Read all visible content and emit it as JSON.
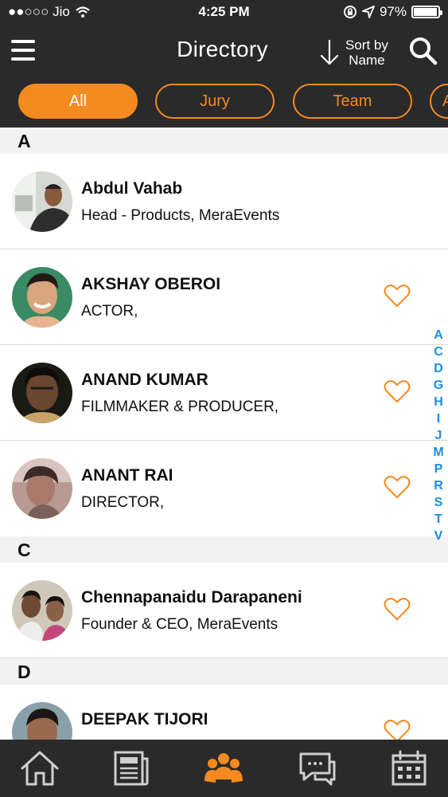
{
  "status_bar": {
    "carrier": "●●○○○ Jio",
    "time": "4:25 PM",
    "battery": "97%",
    "battery_level": 0.97
  },
  "header": {
    "title": "Directory",
    "sort_line1": "Sort by",
    "sort_line2": "Name"
  },
  "filters": [
    {
      "label": "All",
      "active": true
    },
    {
      "label": "Jury",
      "active": false
    },
    {
      "label": "Team",
      "active": false
    },
    {
      "label": "A",
      "active": false
    }
  ],
  "sections": [
    {
      "letter": "A",
      "people": [
        {
          "name": "Abdul Vahab",
          "role": "Head - Products, MeraEvents",
          "favorite_icon": false
        },
        {
          "name": "AKSHAY OBEROI",
          "role": "ACTOR,",
          "favorite_icon": true
        },
        {
          "name": "ANAND KUMAR",
          "role": "FILMMAKER & PRODUCER,",
          "favorite_icon": true
        },
        {
          "name": "ANANT RAI",
          "role": "DIRECTOR,",
          "favorite_icon": true
        }
      ]
    },
    {
      "letter": "C",
      "people": [
        {
          "name": "Chennapanaidu Darapaneni",
          "role": "Founder & CEO, MeraEvents",
          "favorite_icon": true
        }
      ]
    },
    {
      "letter": "D",
      "people": [
        {
          "name": "DEEPAK TIJORI",
          "role": "",
          "favorite_icon": true
        }
      ]
    }
  ],
  "index_letters": [
    "A",
    "C",
    "D",
    "G",
    "H",
    "I",
    "J",
    "M",
    "P",
    "R",
    "S",
    "T",
    "V"
  ],
  "bottom_nav": [
    "home-icon",
    "news-icon",
    "directory-icon",
    "chat-icon",
    "calendar-icon"
  ],
  "colors": {
    "accent": "#f58a1f",
    "bar": "#2a2a2a",
    "index": "#1a8fe3"
  }
}
